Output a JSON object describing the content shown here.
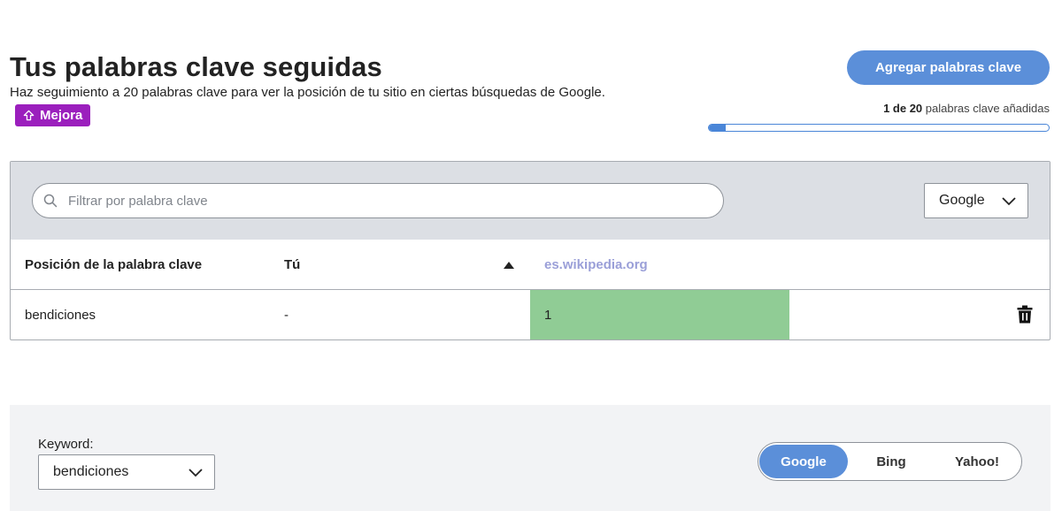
{
  "header": {
    "title": "Tus palabras clave seguidas",
    "subtitle": "Haz seguimiento a 20 palabras clave para ver la posición de tu sitio en ciertas búsquedas de Google.",
    "upgrade_badge": "Mejora",
    "add_button": "Agregar palabras clave",
    "count_strong": "1 de 20",
    "count_rest": " palabras clave añadidas",
    "progress_fraction": 0.05
  },
  "filter": {
    "search_placeholder": "Filtrar por palabra clave",
    "search_value": "",
    "engine_selected": "Google"
  },
  "table": {
    "columns": [
      "Posición de la palabra clave",
      "Tú",
      "es.wikipedia.org"
    ],
    "rows": [
      {
        "keyword": "bendiciones",
        "you": "-",
        "competitor": "1"
      }
    ]
  },
  "bottom": {
    "keyword_label": "Keyword:",
    "keyword_selected": "bendiciones",
    "engines": [
      "Google",
      "Bing",
      "Yahoo!"
    ],
    "active_engine": "Google"
  },
  "colors": {
    "accent": "#5b8fd9",
    "badge": "#9b1fbd",
    "rank_good": "#90cc95",
    "competitor_header": "#9a9fd8"
  }
}
